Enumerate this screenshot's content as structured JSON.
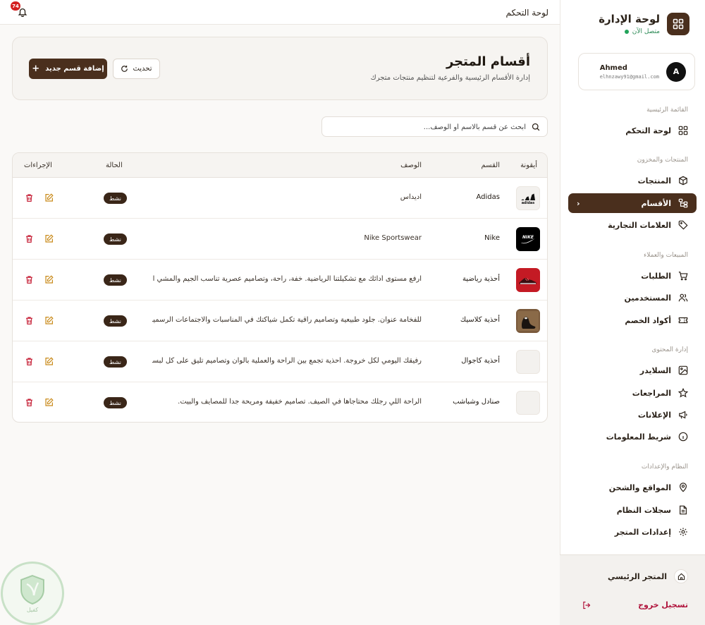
{
  "colors": {
    "accent": "#4a2f1d",
    "background": "#faf9f7",
    "status_online": "#22a35a",
    "danger": "#b0143c",
    "badge": "#d32020"
  },
  "sidebar": {
    "brand_title": "لوحة الإدارة",
    "brand_status": "متصل الآن",
    "brand_icon": "grid-icon",
    "profile": {
      "avatar_initial": "A",
      "name": "Ahmed",
      "email": "elhnzawy91@gmail.com"
    },
    "sections": [
      {
        "title": "القائمة الرئيسية",
        "items": [
          {
            "label": "لوحة التحكم",
            "icon": "grid-icon"
          }
        ]
      },
      {
        "title": "المنتجات والمخزون",
        "items": [
          {
            "label": "المنتجات",
            "icon": "box-icon"
          },
          {
            "label": "الأقسام",
            "icon": "hierarchy-icon",
            "active": true
          },
          {
            "label": "العلامات التجارية",
            "icon": "tag-icon"
          }
        ]
      },
      {
        "title": "المبيعات والعملاء",
        "items": [
          {
            "label": "الطلبات",
            "icon": "cart-icon"
          },
          {
            "label": "المستخدمين",
            "icon": "users-icon"
          },
          {
            "label": "أكواد الخصم",
            "icon": "ticket-icon"
          }
        ]
      },
      {
        "title": "إدارة المحتوى",
        "items": [
          {
            "label": "السلايدر",
            "icon": "image-icon"
          },
          {
            "label": "المراجعات",
            "icon": "star-icon"
          },
          {
            "label": "الإعلانات",
            "icon": "megaphone-icon"
          },
          {
            "label": "شريط المعلومات",
            "icon": "info-icon"
          }
        ]
      },
      {
        "title": "النظام والإعدادات",
        "items": [
          {
            "label": "المواقع والشحن",
            "icon": "location-icon"
          },
          {
            "label": "سجلات النظام",
            "icon": "file-icon"
          },
          {
            "label": "إعدادات المتجر",
            "icon": "gear-icon"
          }
        ]
      }
    ],
    "main_store": "المتجر الرئيسي",
    "logout": "تسجيل خروج"
  },
  "topbar": {
    "title": "لوحة التحكم",
    "notifications": "74"
  },
  "header": {
    "title": "أقسام المتجر",
    "subtitle": "إدارة الأقسام الرئيسية والفرعية لتنظيم منتجات متجرك",
    "add_button": "إضافة قسم جديد",
    "refresh_button": "تحديث"
  },
  "search": {
    "placeholder": "ابحث عن قسم بالاسم أو الوصف..."
  },
  "table": {
    "columns": {
      "icon": "أيقونة",
      "name": "القسم",
      "description": "الوصف",
      "status": "الحالة",
      "actions": "الإجراءات"
    },
    "rows": [
      {
        "name": "Adidas",
        "description": "اديداس",
        "status": "نشط",
        "thumb": "adidas-logo"
      },
      {
        "name": "Nike",
        "description": "Nike Sportswear",
        "status": "نشط",
        "thumb": "nike-logo"
      },
      {
        "name": "أحذية رياضية",
        "description": "ارفع مستوى أدائك مع تشكيلتنا الرياضية. خفة، راحة، وتصاميم عصرية تناسب الجيم والمشي اليو...",
        "status": "نشط",
        "thumb": "sport-shoe"
      },
      {
        "name": "أحذية كلاسيك",
        "description": "للفخامة عنوان. جلود طبيعية وتصاميم راقية تكمل شياكتك في المناسبات والاجتماعات الرسمية.",
        "status": "نشط",
        "thumb": "classic-shoe"
      },
      {
        "name": "أحذية كاجوال",
        "description": "رفيقك اليومي لكل خروجة. أحذية تجمع بين الراحة والعملية بألوان وتصاميم تليق على كل لبسك.",
        "status": "نشط",
        "thumb": "empty"
      },
      {
        "name": "صنادل وشباشب",
        "description": "الراحة اللي رجلك محتاجاها في الصيف. تصاميم خفيفة ومريحة جداً للمصايف والبيت.",
        "status": "نشط",
        "thumb": "empty"
      }
    ]
  },
  "watermark_text": "كفيل"
}
